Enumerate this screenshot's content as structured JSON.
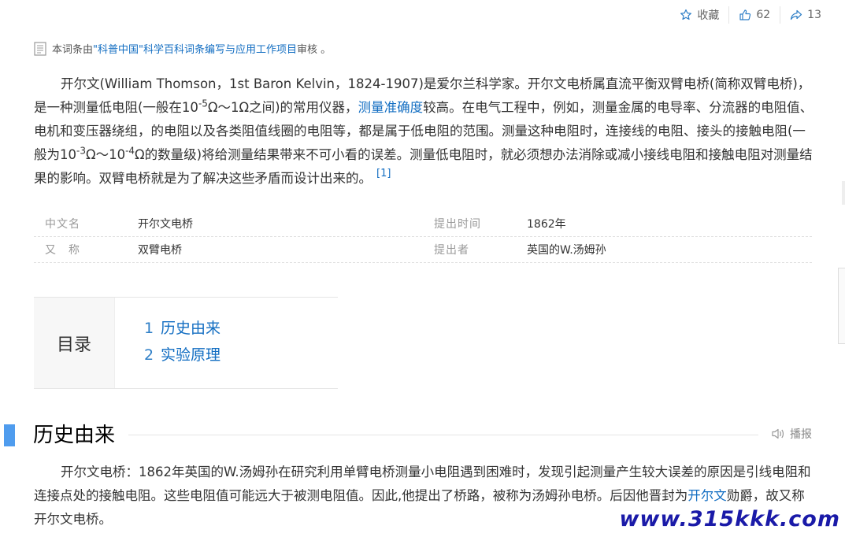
{
  "actions": {
    "favorite_label": "收藏",
    "like_count": "62",
    "share_count": "13"
  },
  "review": {
    "prefix": "本词条由",
    "link": "\"科普中国\"科学百科词条编写与应用工作项目",
    "suffix": " 审核 。"
  },
  "summary": {
    "part1": "开尔文(William Thomson，1st Baron Kelvin，1824-1907)是爱尔兰科学家。开尔文电桥属直流平衡双臂电桥(简称双臂电桥)，是一种测量低电阻(一般在10",
    "sup1": "-5",
    "part2": "Ω～1Ω之间)的常用仪器，",
    "link": "测量准确度",
    "part3": "较高。在电气工程中，例如，测量金属的电导率、分流器的电阻值、电机和变压器绕组，的电阻以及各类阻值线圈的电阻等，都是属于低电阻的范围。测量这种电阻时，连接线的电阻、接头的接触电阻(一般为10",
    "sup2": "-3",
    "part4": "Ω～10",
    "sup3": "-4",
    "part5": "Ω的数量级)将给测量结果带来不可小看的误差。测量低电阻时，就必须想办法消除或减小接线电阻和接触电阻对测量结果的影响。双臂电桥就是为了解决这些矛盾而设计出来的。",
    "ref": "[1]"
  },
  "basic_info": {
    "rows": [
      {
        "left_name": "中文名",
        "left_value": "开尔文电桥",
        "right_name": "提出时间",
        "right_value": "1862年"
      },
      {
        "left_name": "又　称",
        "left_value": "双臂电桥",
        "right_name": "提出者",
        "right_value": "英国的W.汤姆孙"
      }
    ]
  },
  "catalog": {
    "title": "目录",
    "items": [
      {
        "num": "1",
        "label": "历史由来"
      },
      {
        "num": "2",
        "label": "实验原理"
      }
    ]
  },
  "section": {
    "title": "历史由来",
    "play_label": "播报"
  },
  "paragraph": {
    "text": "开尔文电桥：1862年英国的W.汤姆孙在研究利用单臂电桥测量小电阻遇到困难时，发现引起测量产生较大误差的原因是引线电阻和连接点处的接触电阻。这些电阻值可能远大于被测电阻值。因此,他提出了桥路，被称为汤姆孙电桥。后因他晋封为",
    "link": "开尔文",
    "tail": "勋爵，故又称开尔文电桥。"
  },
  "watermark": "www.315kkk.com",
  "colors": {
    "link": "#136ec2",
    "section_bar": "#4f9cee",
    "watermark": "#1a1aa8"
  }
}
